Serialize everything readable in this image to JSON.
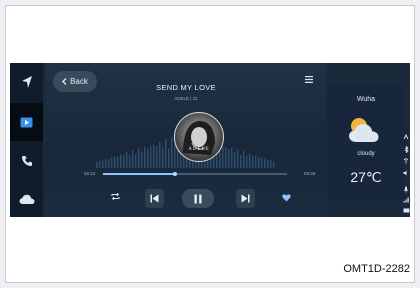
{
  "player": {
    "back_label": "Back",
    "song_title": "SEND MY LOVE",
    "artist": "ADELE | 21",
    "album_label": "ADELE",
    "elapsed": "02:14",
    "duration": "03:46",
    "progress": 0.39
  },
  "weather": {
    "city": "Wuha",
    "condition": "cloudy",
    "temperature": "27℃"
  },
  "figure_code": "OMT1D-2282",
  "colors": {
    "screen_bg": "#1b2a3a",
    "accent": "#8fc3ff",
    "favorite": "#8fc3ff"
  }
}
